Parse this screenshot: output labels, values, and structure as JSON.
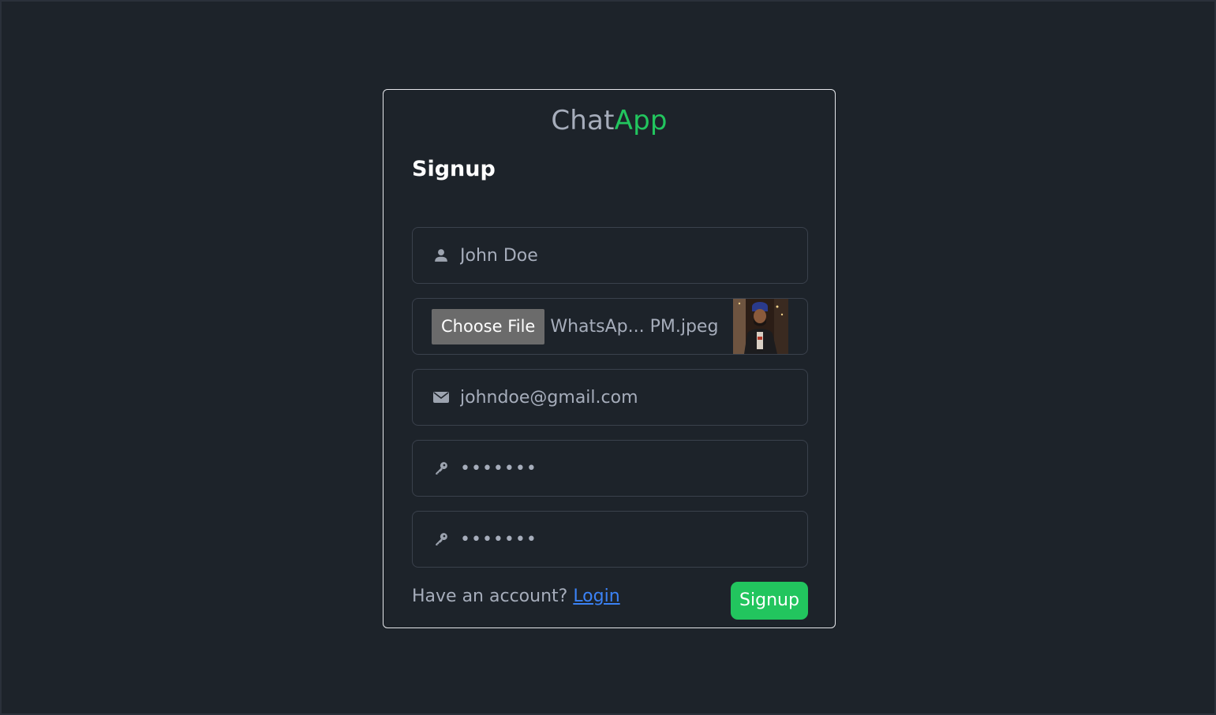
{
  "brand": {
    "part1": "Chat",
    "part2": "App"
  },
  "form": {
    "heading": "Signup",
    "name": {
      "value": "John Doe",
      "icon": "user-icon"
    },
    "file": {
      "button_label": "Choose File",
      "file_name": "WhatsAp... PM.jpeg"
    },
    "email": {
      "value": "johndoe@gmail.com",
      "icon": "envelope-icon"
    },
    "password": {
      "value": "1234567",
      "icon": "key-icon"
    },
    "confirm_password": {
      "value": "1234567",
      "icon": "key-icon"
    },
    "footer": {
      "prompt": "Have an account? ",
      "login_label": "Login"
    },
    "submit_label": "Signup"
  },
  "colors": {
    "background": "#1d232a",
    "accent": "#22c55e",
    "link": "#3b82f6",
    "text_muted": "#a6adbb"
  }
}
